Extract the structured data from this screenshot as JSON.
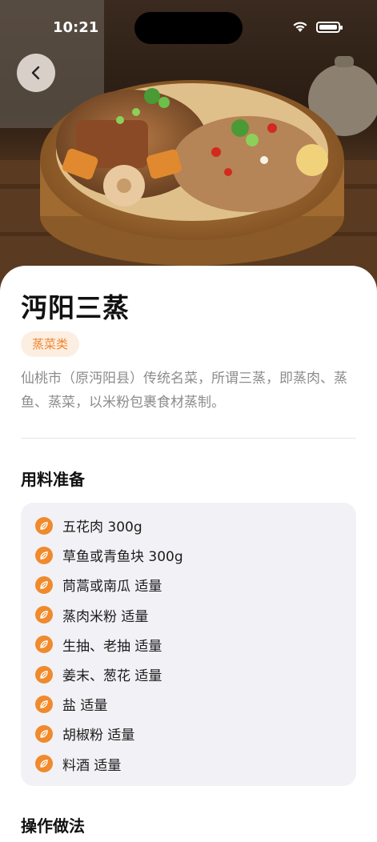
{
  "status_bar": {
    "time": "10:21"
  },
  "icons": {
    "back": "chevron-left-icon",
    "ingredient_bullet": "leaf-icon"
  },
  "colors": {
    "accent": "#f08a2c",
    "tag_bg": "#fdeee2",
    "card_bg": "#f2f2f6"
  },
  "recipe": {
    "title": "沔阳三蒸",
    "category": "蒸菜类",
    "description": "仙桃市（原沔阳县）传统名菜，所谓三蒸，即蒸肉、蒸鱼、蒸菜，以米粉包裹食材蒸制。",
    "ingredients_title": "用料准备",
    "ingredients": [
      "五花肉 300g",
      "草鱼或青鱼块 300g",
      "茼蒿或南瓜 适量",
      "蒸肉米粉 适量",
      "生抽、老抽 适量",
      "姜末、葱花 适量",
      "盐 适量",
      "胡椒粉 适量",
      "料酒 适量"
    ],
    "next_section_title": "操作做法"
  }
}
